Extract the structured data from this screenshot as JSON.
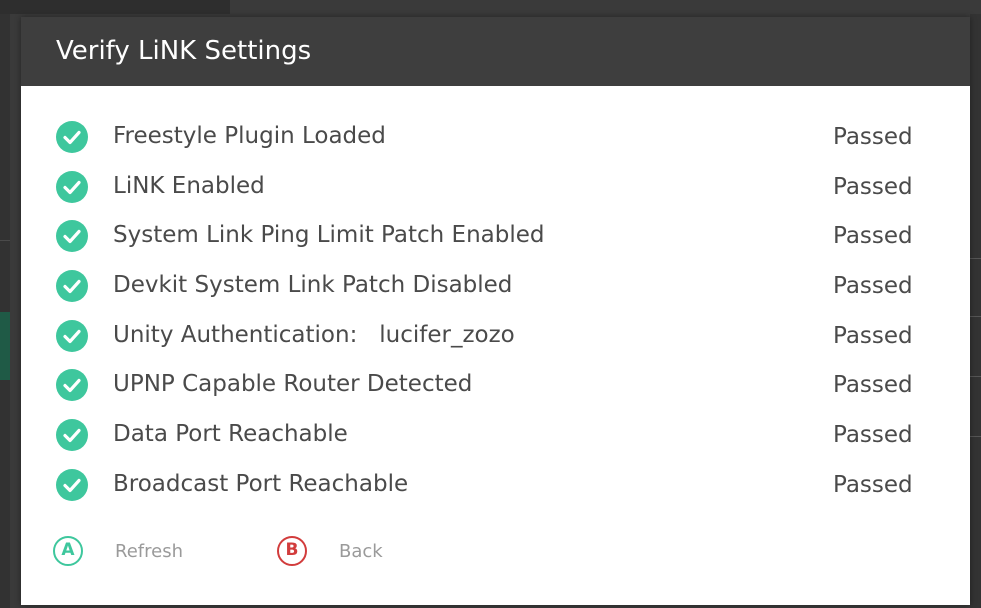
{
  "dialog": {
    "title": "Verify LiNK Settings"
  },
  "checks": [
    {
      "label": "Freestyle Plugin Loaded",
      "status": "Passed",
      "icon": "check-circle-icon"
    },
    {
      "label": "LiNK Enabled",
      "status": "Passed",
      "icon": "check-circle-icon"
    },
    {
      "label": "System Link Ping Limit Patch Enabled",
      "status": "Passed",
      "icon": "check-circle-icon"
    },
    {
      "label": "Devkit System Link Patch Disabled",
      "status": "Passed",
      "icon": "check-circle-icon"
    },
    {
      "label": "Unity Authentication:   lucifer_zozo",
      "status": "Passed",
      "icon": "check-circle-icon"
    },
    {
      "label": "UPNP Capable Router Detected",
      "status": "Passed",
      "icon": "check-circle-icon"
    },
    {
      "label": "Data Port Reachable",
      "status": "Passed",
      "icon": "check-circle-icon"
    },
    {
      "label": "Broadcast Port Reachable",
      "status": "Passed",
      "icon": "check-circle-icon"
    }
  ],
  "footer": {
    "refresh": {
      "key": "A",
      "label": "Refresh",
      "color": "#3ec79d"
    },
    "back": {
      "key": "B",
      "label": "Back",
      "color": "#d23c3c"
    }
  },
  "colors": {
    "header_bg": "#3e3e3e",
    "check_green": "#3ec79d",
    "text": "#4a4a4a"
  }
}
